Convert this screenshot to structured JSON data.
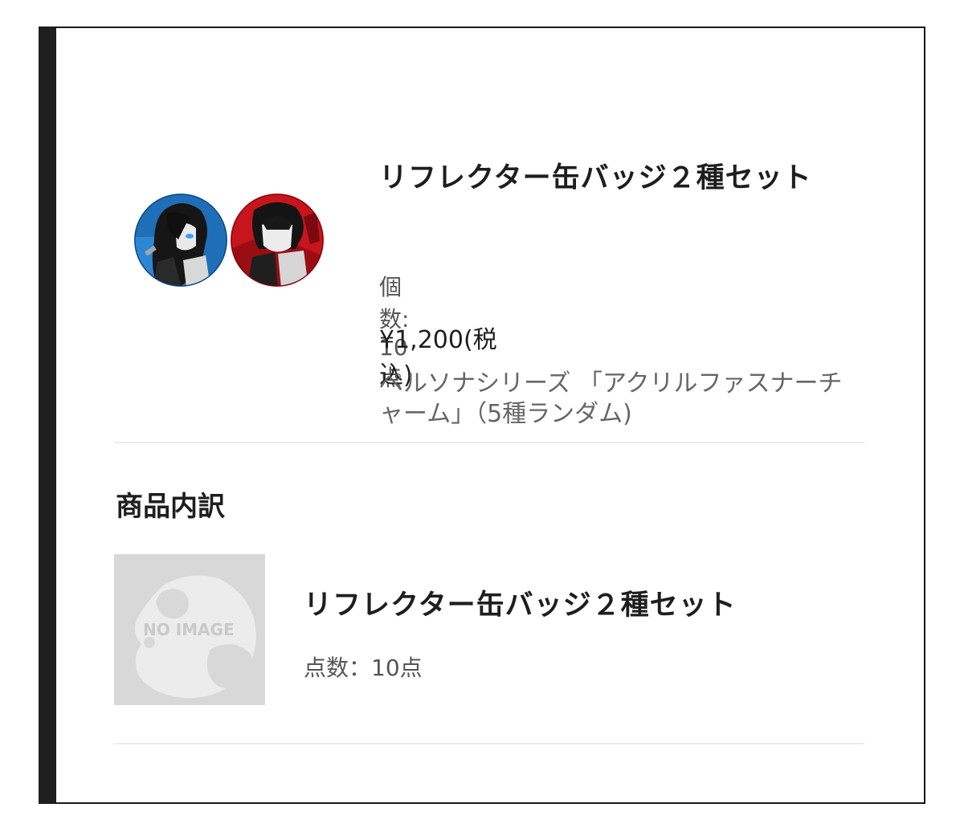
{
  "product": {
    "title": "リフレクター缶バッジ２種セット",
    "quantity": "個数: 10点",
    "price": "¥1,200(税込)",
    "description": "ペルソナシリーズ 「アクリルファスナーチャーム」（5種ランダム)"
  },
  "breakdown": {
    "heading": "商品内訳",
    "items": [
      {
        "image_label": "NO IMAGE",
        "title": "リフレクター缶バッジ２種セット",
        "quantity": "点数：10点"
      }
    ]
  },
  "colors": {
    "frame_border": "#1f1f1f",
    "badge_blue": "#1f6fb8",
    "badge_red": "#c8141c",
    "placeholder_bg": "#d8d8d8"
  }
}
